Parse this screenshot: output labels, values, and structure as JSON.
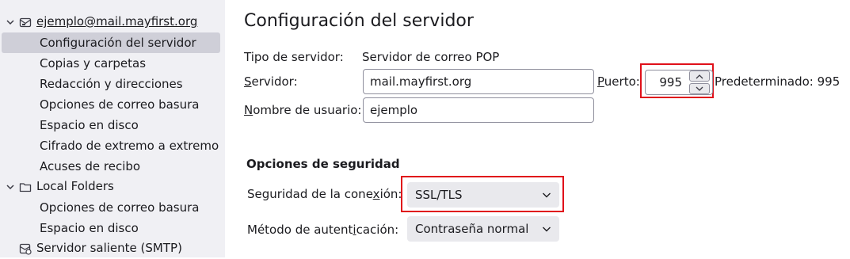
{
  "sidebar": {
    "account": {
      "name": "ejemplo@mail.mayfirst.org"
    },
    "account_items": [
      {
        "label": "Configuración del servidor"
      },
      {
        "label": "Copias y carpetas"
      },
      {
        "label": "Redacción y direcciones"
      },
      {
        "label": "Opciones de correo basura"
      },
      {
        "label": "Espacio en disco"
      },
      {
        "label": "Cifrado de extremo a extremo"
      },
      {
        "label": "Acuses de recibo"
      }
    ],
    "local_folders": {
      "name": "Local Folders"
    },
    "local_items": [
      {
        "label": "Opciones de correo basura"
      },
      {
        "label": "Espacio en disco"
      }
    ],
    "smtp": {
      "label": "Servidor saliente (SMTP)"
    }
  },
  "main": {
    "title": "Configuración del servidor",
    "server_type": {
      "label": "Tipo de servidor:",
      "value": "Servidor de correo POP"
    },
    "server": {
      "label_first": "S",
      "label_rest": "ervidor:",
      "value": "mail.mayfirst.org"
    },
    "port": {
      "label_first": "P",
      "label_rest": "uerto:",
      "value": "995",
      "default_text": "Predeterminado: 995"
    },
    "username": {
      "label_first": "N",
      "label_rest": "ombre de usuario:",
      "value": "ejemplo"
    },
    "security": {
      "title": "Opciones de seguridad",
      "connection": {
        "label_pre": "Seguridad de la cone",
        "label_key": "x",
        "label_post": "ión:",
        "value": "SSL/TLS"
      },
      "auth": {
        "label_pre": "Método de autent",
        "label_key": "i",
        "label_post": "cación:",
        "value": "Contraseña normal"
      }
    }
  },
  "colors": {
    "highlight": "#e0101a",
    "sidebar_bg": "#f0f0f4",
    "selected_bg": "#cfcfd8"
  },
  "icons": [
    "chevron-down-icon",
    "account-mail-icon",
    "folder-icon",
    "outgoing-server-icon",
    "spin-up-icon",
    "spin-down-icon"
  ]
}
